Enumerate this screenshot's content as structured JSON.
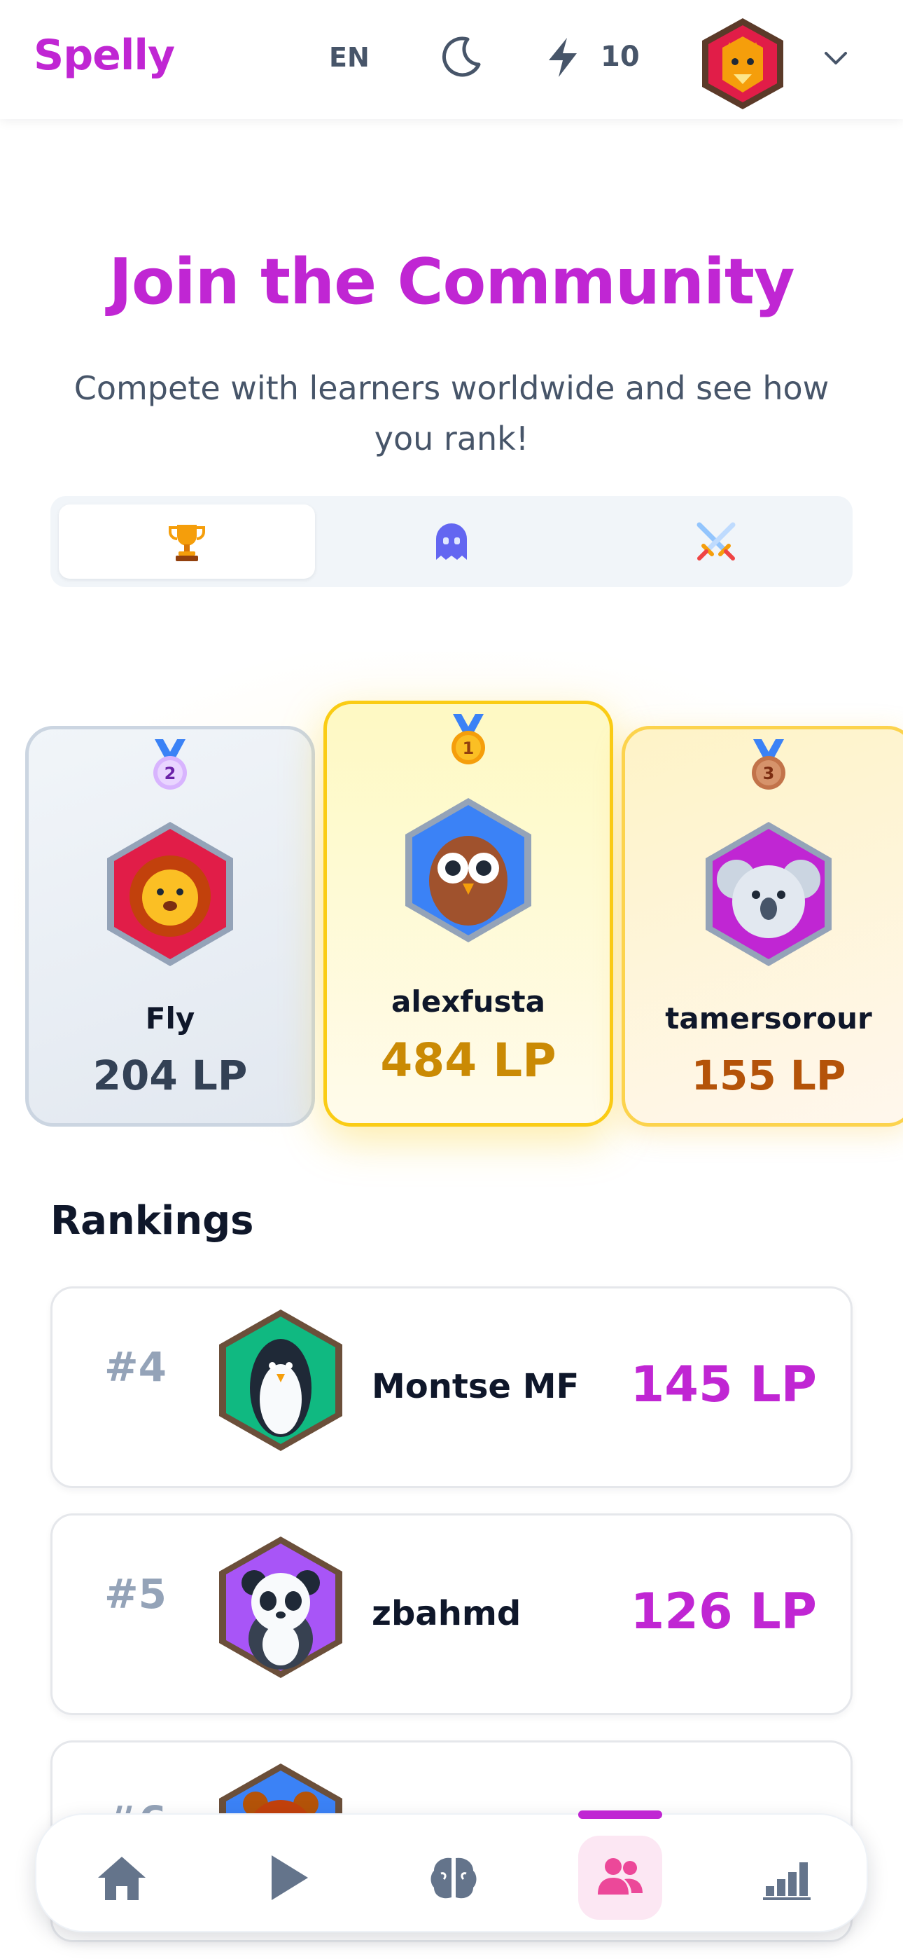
{
  "header": {
    "logo": "Spelly",
    "language": "EN",
    "theme_icon": "moon-icon",
    "energy_icon": "bolt-icon",
    "energy_count": "10",
    "avatar_icon": "fox-avatar-icon",
    "menu_icon": "chevron-down-icon"
  },
  "hero": {
    "title": "Join the Community",
    "subtitle": "Compete with learners worldwide and see how you rank!"
  },
  "tabs": [
    {
      "icon": "trophy-icon",
      "active": true
    },
    {
      "icon": "ghost-icon",
      "active": false
    },
    {
      "icon": "crossed-swords-icon",
      "active": false
    }
  ],
  "podium": {
    "first": {
      "medal": "1",
      "name": "alexfusta",
      "score": "484 LP",
      "avatar": "owl-avatar-icon"
    },
    "second": {
      "medal": "2",
      "name": "Fly",
      "score": "204 LP",
      "avatar": "lion-avatar-icon"
    },
    "third": {
      "medal": "3",
      "name": "tamersorour",
      "score": "155 LP",
      "avatar": "koala-avatar-icon"
    }
  },
  "rankings": {
    "heading": "Rankings",
    "rows": [
      {
        "rank": "#4",
        "name": "Montse MF",
        "score": "145 LP",
        "avatar": "penguin-avatar-icon"
      },
      {
        "rank": "#5",
        "name": "zbahmd",
        "score": "126 LP",
        "avatar": "panda-avatar-icon"
      },
      {
        "rank": "#6",
        "name": "",
        "score": "",
        "avatar": "bear-avatar-icon"
      }
    ]
  },
  "nav": [
    {
      "icon": "home-icon",
      "active": false
    },
    {
      "icon": "play-icon",
      "active": false
    },
    {
      "icon": "brain-icon",
      "active": false
    },
    {
      "icon": "community-icon",
      "active": true
    },
    {
      "icon": "leaderboard-icon",
      "active": false
    }
  ],
  "colors": {
    "brand": "#c026d3",
    "gold": "#ca8a04",
    "bronze": "#b45309",
    "silver": "#334155"
  }
}
